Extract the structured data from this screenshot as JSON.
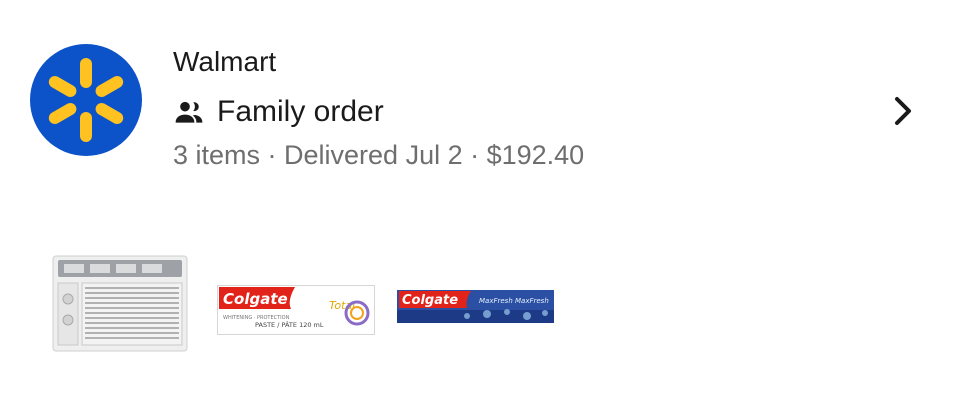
{
  "order": {
    "store_name": "Walmart",
    "logo_icon": "walmart-spark-icon",
    "brand_color": "#0c53c9",
    "spark_color": "#ffc220",
    "order_type_icon": "people-icon",
    "order_type": "Family order",
    "summary": "3 items · Delivered Jul 2 · $192.40",
    "chevron_icon": "chevron-right-icon",
    "items": [
      {
        "name": "window-air-conditioner",
        "image_icon": "air-conditioner-thumbnail"
      },
      {
        "name": "colgate-total-toothpaste",
        "brand": "Colgate",
        "sub": "Total",
        "size": "120 mL",
        "image_icon": "toothpaste-thumbnail"
      },
      {
        "name": "colgate-maxfresh-toothpaste",
        "brand": "Colgate",
        "sub": "MaxFresh",
        "image_icon": "toothpaste-thumbnail"
      }
    ]
  }
}
